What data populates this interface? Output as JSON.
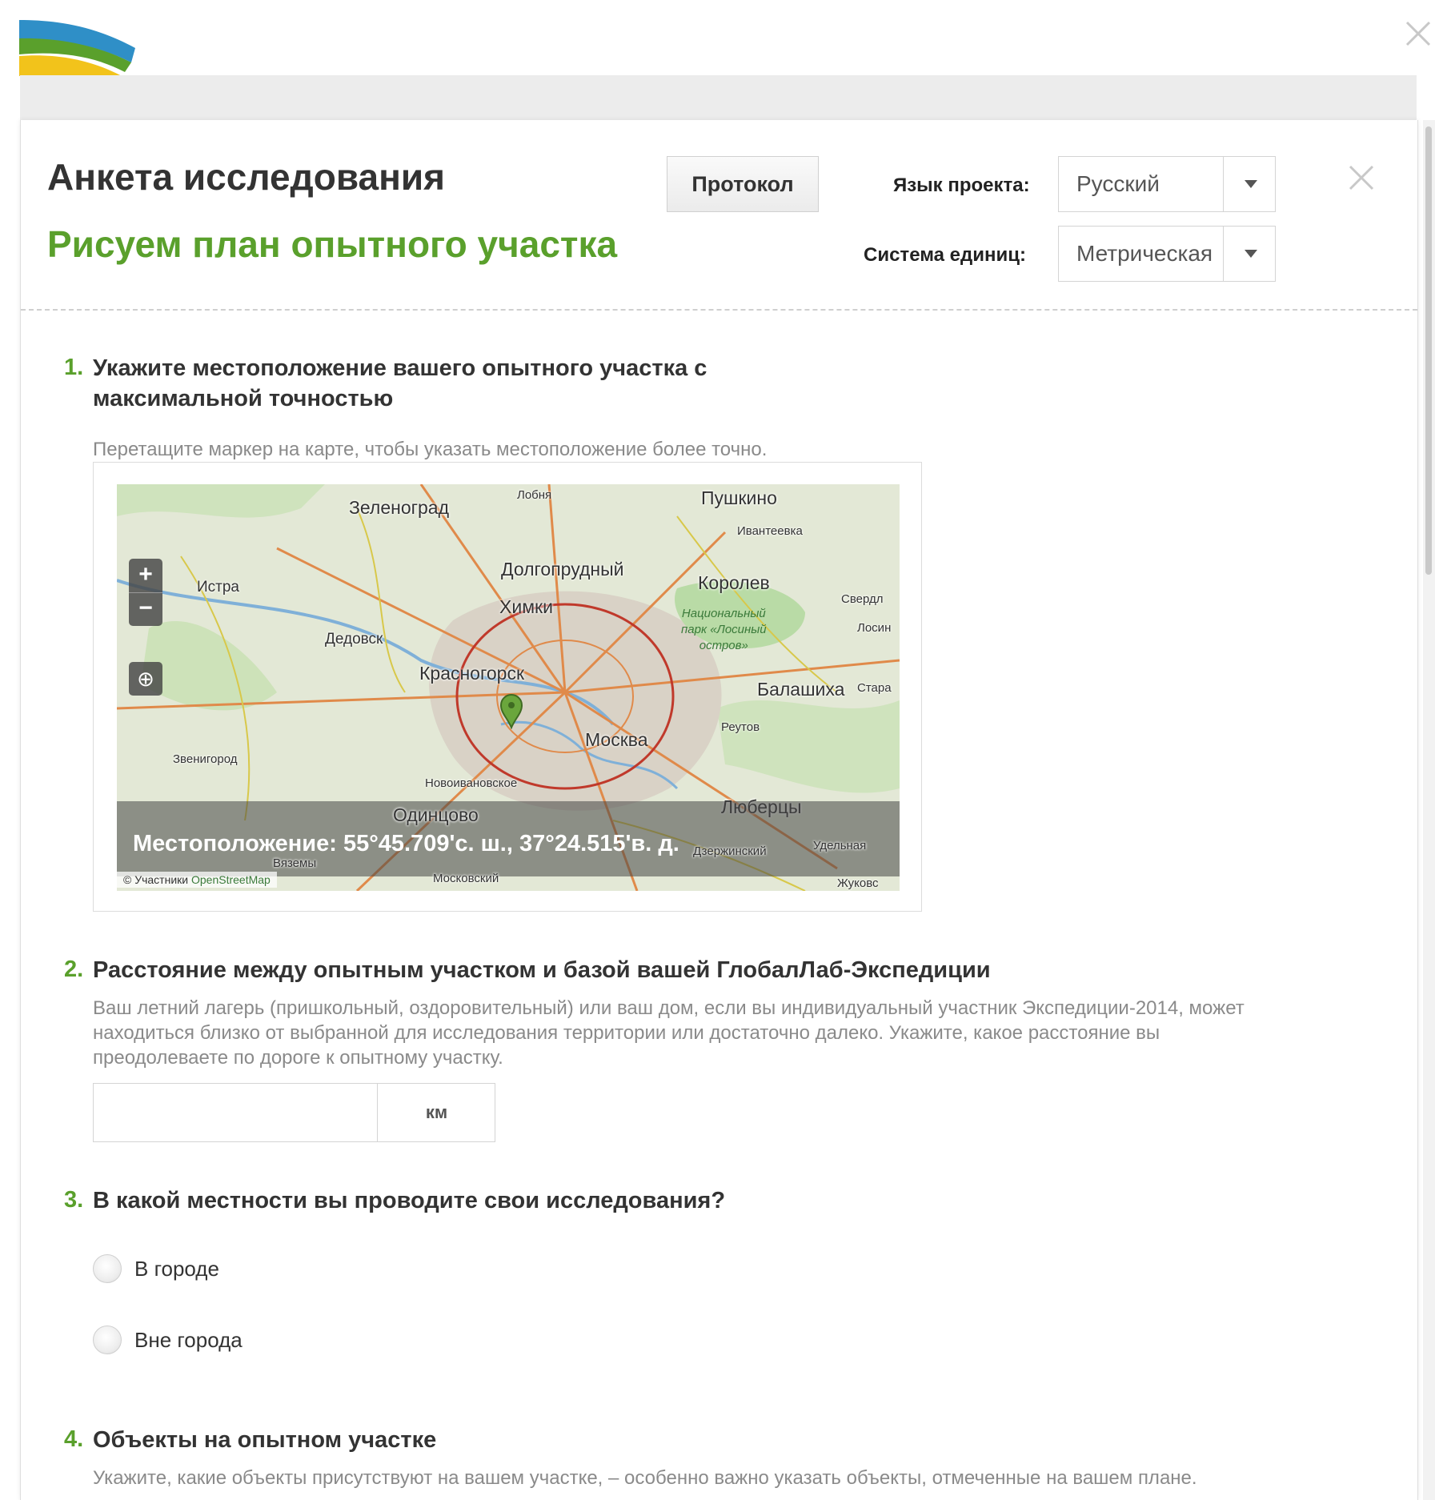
{
  "header": {
    "logo_colors": [
      "#2f8fc7",
      "#5aa02c",
      "#f2c31b"
    ]
  },
  "survey": {
    "title": "Анкета исследования",
    "subtitle": "Рисуем план опытного участка",
    "protocol_button": "Протокол",
    "language": {
      "label": "Язык проекта:",
      "value": "Русский"
    },
    "units": {
      "label": "Система единиц:",
      "value": "Метрическая"
    }
  },
  "questions": {
    "q1": {
      "number": "1.",
      "text_line1": "Укажите местоположение вашего опытного участка с",
      "text_line2": "максимальной точностью",
      "hint": "Перетащите маркер на карте, чтобы указать местоположение более точно."
    },
    "q2": {
      "number": "2.",
      "text": "Расстояние между опытным участком и базой вашей ГлобалЛаб-Экспедиции",
      "hint_line1": "Ваш летний лагерь (пришкольный, оздоровительный) или ваш дом, если вы индивидуальный участник Экспедиции-2014, может",
      "hint_line2": "находиться близко от выбранной для исследования территории или достаточно далеко. Укажите, какое расстояние вы",
      "hint_line3": "преодолеваете по дороге к опытному участку.",
      "input_value": "",
      "unit": "км"
    },
    "q3": {
      "number": "3.",
      "text": "В какой местности вы проводите свои исследования?",
      "options": [
        "В городе",
        "Вне города"
      ]
    },
    "q4": {
      "number": "4.",
      "text": "Объекты на опытном участке",
      "hint": "Укажите, какие объекты присутствуют на вашем участке, – особенно важно указать объекты, отмеченные на вашем плане."
    }
  },
  "map": {
    "location_text": "Местоположение: 55°45.709'с. ш., 37°24.515'в. д.",
    "attribution_prefix": "© Участники",
    "attribution_link": "OpenStreetMap",
    "zoom_in": "+",
    "zoom_out": "−",
    "locate_icon": "⊕",
    "park_label": [
      "Национальный",
      "парк «Лосиный",
      "остров»"
    ],
    "places": {
      "zelenograd": "Зеленоград",
      "lobnya": "Лобня",
      "pushkino": "Пушкино",
      "ivanteevka": "Ивантеевка",
      "dolgoprudny": "Долгопрудный",
      "korolev": "Королев",
      "istra": "Истра",
      "khimki": "Химки",
      "sverdl": "Свердл",
      "losin": "Лосин",
      "dedovsk": "Дедовск",
      "krasnogorsk": "Красногорск",
      "balashikha": "Балашиха",
      "stara": "Стара",
      "moskva": "Москва",
      "reutov": "Реутов",
      "zvenigorod": "Звенигород",
      "novoivanovskoe": "Новоивановское",
      "lyubertsy": "Люберцы",
      "odintsovo": "Одинцово",
      "dzerzhinsky": "Дзержинский",
      "udelnaya": "Удельная",
      "vyazemy": "Вяземы",
      "moskovsky": "Московский",
      "zhukovsky": "Жуковс"
    },
    "colors": {
      "marker": "#6aa63c",
      "park": "#b9dba6",
      "city": "#d9d2c6",
      "roads": "#e08a4a"
    }
  }
}
